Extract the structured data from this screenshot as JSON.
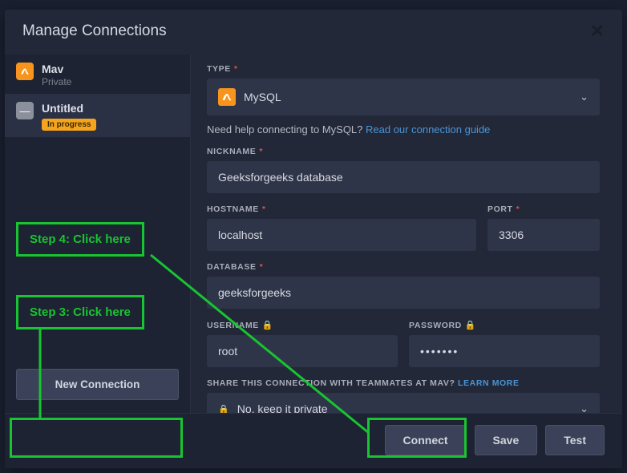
{
  "modal": {
    "title": "Manage Connections"
  },
  "sidebar": {
    "items": [
      {
        "name": "Mav",
        "sub": "Private",
        "icon": "orange"
      },
      {
        "name": "Untitled",
        "badge": "In progress",
        "icon": "gray"
      }
    ],
    "new_connection_label": "New Connection"
  },
  "form": {
    "type_label": "TYPE",
    "type_value": "MySQL",
    "help_prefix": "Need help connecting to MySQL? ",
    "help_link": "Read our connection guide",
    "nickname_label": "NICKNAME",
    "nickname_value": "Geeksforgeeks database",
    "hostname_label": "HOSTNAME",
    "hostname_value": "localhost",
    "port_label": "PORT",
    "port_value": "3306",
    "database_label": "DATABASE",
    "database_value": "geeksforgeeks",
    "username_label": "USERNAME",
    "username_value": "root",
    "password_label": "PASSWORD",
    "password_value": "•••••••",
    "share_label_prefix": "SHARE THIS CONNECTION WITH TEAMMATES AT MAV? ",
    "share_learn_more": "LEARN MORE",
    "share_value": "No, keep it private"
  },
  "footer": {
    "connect": "Connect",
    "save": "Save",
    "test": "Test"
  },
  "annotations": {
    "step3": "Step 3: Click here",
    "step4": "Step 4: Click here"
  }
}
